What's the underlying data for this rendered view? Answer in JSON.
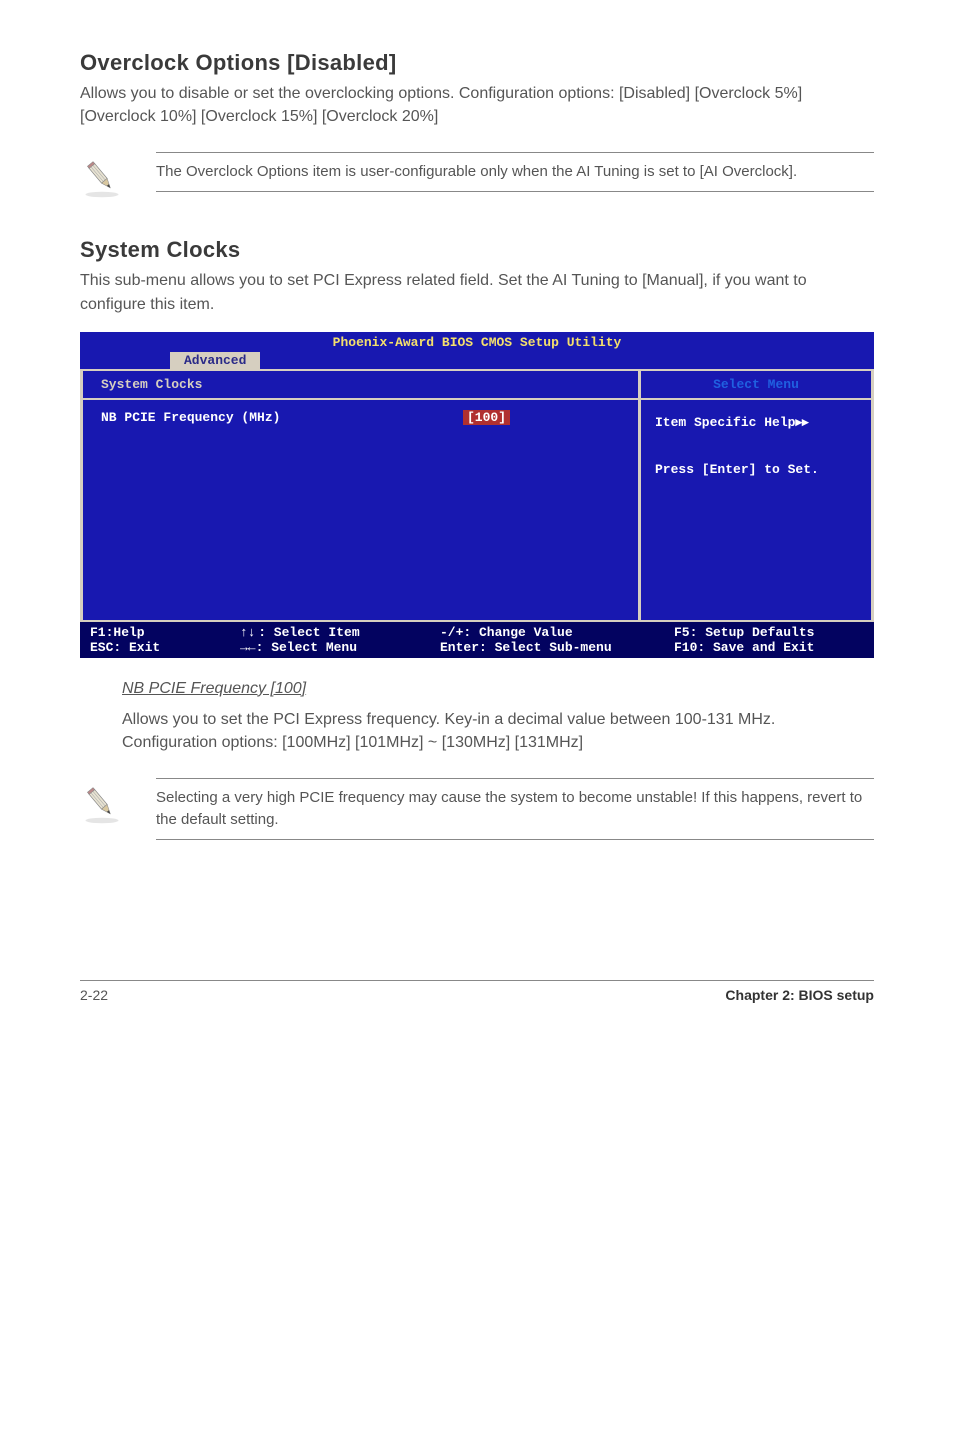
{
  "section1": {
    "heading": "Overclock Options [Disabled]",
    "para": "Allows you to disable or set the overclocking options. Configuration options: [Disabled] [Overclock 5%] [Overclock 10%] [Overclock 15%] [Overclock 20%]",
    "note": "The Overclock Options item is user-configurable only when the AI Tuning is set to [AI Overclock]."
  },
  "section2": {
    "heading": "System Clocks",
    "para": "This sub-menu allows you to set PCI Express related field. Set the AI Tuning to [Manual], if you want to configure this item."
  },
  "bios": {
    "title": "Phoenix-Award BIOS CMOS Setup Utility",
    "tab": "Advanced",
    "left_header": "System Clocks",
    "right_header": "Select Menu",
    "field_label": "NB PCIE Frequency (MHz)",
    "field_value": "[100]",
    "help_line1": "Item Specific Help",
    "help_line2": "Press [Enter] to Set.",
    "footer": {
      "f1": "F1:Help",
      "esc": "ESC: Exit",
      "sel_item": "↑↓ : Select Item",
      "sel_menu": "→←: Select Menu",
      "change": "-/+: Change Value",
      "enter": "Enter: Select Sub-menu",
      "f5": "F5: Setup Defaults",
      "f10": "F10: Save and Exit"
    }
  },
  "sub": {
    "heading": "NB PCIE Frequency [100]",
    "para": "Allows you to set the PCI Express frequency. Key-in a decimal value between 100-131 MHz. Configuration options: [100MHz] [101MHz] ~ [130MHz] [131MHz]",
    "note": "Selecting a very high PCIE frequency may cause the system to become unstable! If this happens, revert to the default setting."
  },
  "footer": {
    "left": "2-22",
    "right": "Chapter 2: BIOS setup"
  }
}
